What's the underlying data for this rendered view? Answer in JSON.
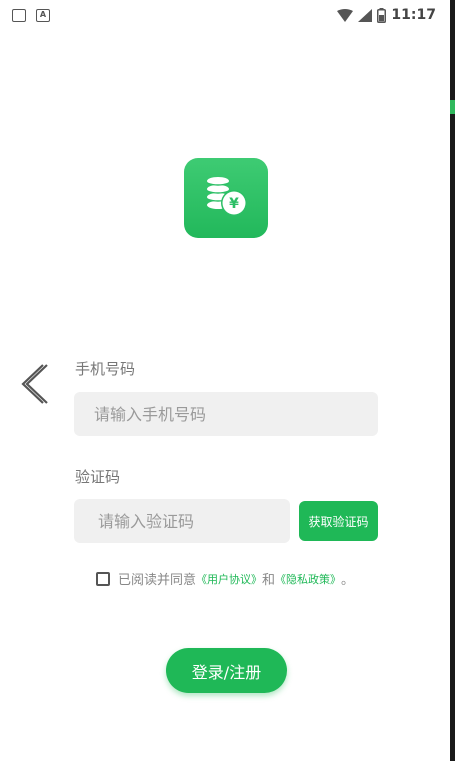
{
  "status_bar": {
    "time": "11:17",
    "left_icons": [
      "notification-icon",
      "app-icon"
    ],
    "app_icon_letter": "A",
    "right_icons": [
      "wifi-icon",
      "signal-icon",
      "battery-icon"
    ]
  },
  "logo": {
    "icon": "coin-yen-icon",
    "symbol": "¥"
  },
  "form": {
    "phone_label": "手机号码",
    "phone_placeholder": "请输入手机号码",
    "code_label": "验证码",
    "code_placeholder": "请输入验证码",
    "get_code_label": "获取验证码"
  },
  "agreement": {
    "prefix": "已阅读并同意",
    "user_agreement": "《用户协议》",
    "conjunction": "和",
    "privacy_policy": "《隐私政策》",
    "suffix": "。"
  },
  "login_label": "登录/注册",
  "colors": {
    "accent": "#1fb857",
    "input_bg": "#f0f0f0",
    "label": "#777777"
  }
}
